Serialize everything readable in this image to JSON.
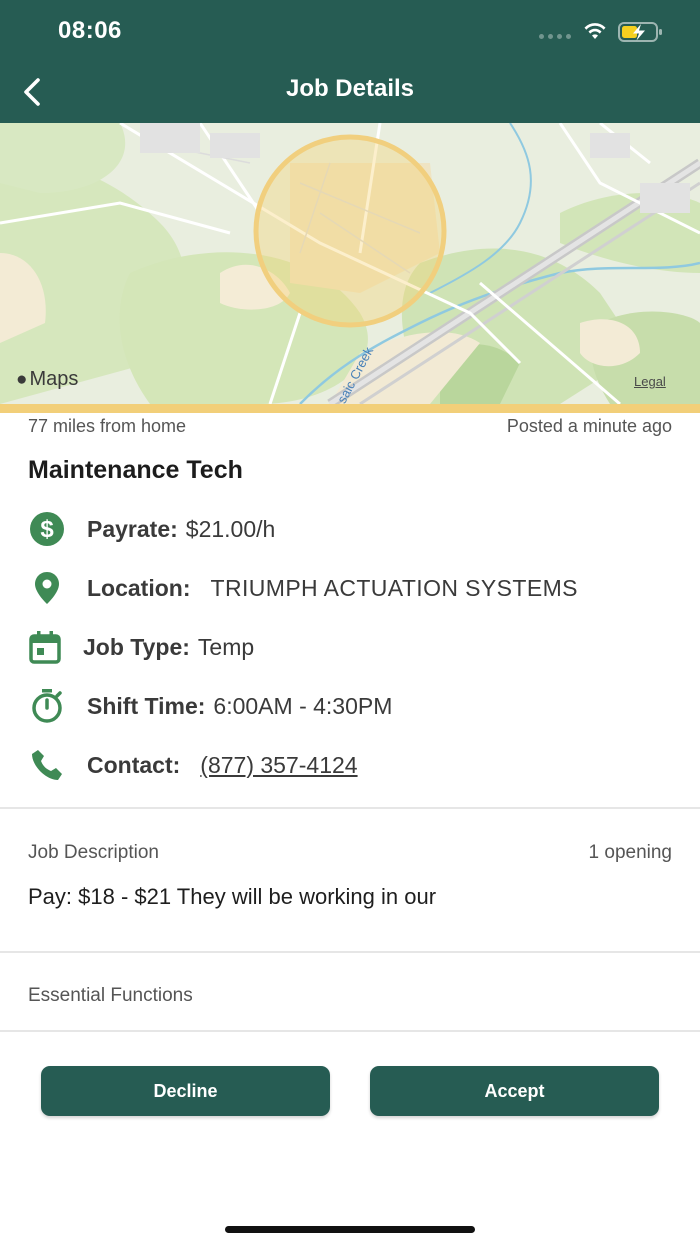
{
  "status_bar": {
    "time": "08:06"
  },
  "header": {
    "title": "Job Details"
  },
  "map": {
    "logo_text": "Maps",
    "legal_text": "Legal",
    "road_label": "saic Creek"
  },
  "job": {
    "distance": "77 miles from home",
    "posted": "Posted a minute ago",
    "title": "Maintenance Tech",
    "details": [
      {
        "label": "Payrate:",
        "value": "$21.00/h",
        "icon": "dollar-circle-icon"
      },
      {
        "label": "Location:",
        "value": "TRIUMPH ACTUATION SYSTEMS",
        "icon": "location-pin-icon"
      },
      {
        "label": "Job Type:",
        "value": "Temp",
        "icon": "calendar-icon"
      },
      {
        "label": "Shift Time:",
        "value": "6:00AM - 4:30PM",
        "icon": "stopwatch-icon"
      },
      {
        "label": "Contact:",
        "value": "(877) 357-4124",
        "icon": "phone-icon"
      }
    ]
  },
  "description": {
    "heading": "Job Description",
    "openings": "1 opening",
    "text": "Pay: $18 - $21 They will be working in our",
    "essential_functions": "Essential Functions"
  },
  "actions": {
    "decline": "Decline",
    "accept": "Accept"
  },
  "colors": {
    "primary": "#265c53",
    "icon_green": "#3f8a55",
    "map_accent": "#f2cf79"
  }
}
